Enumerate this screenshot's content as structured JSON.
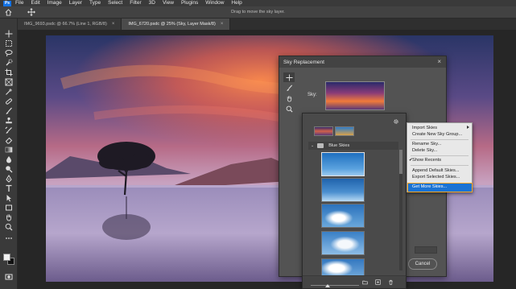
{
  "menubar": {
    "app_icon": "Ps",
    "items": [
      "File",
      "Edit",
      "Image",
      "Layer",
      "Type",
      "Select",
      "Filter",
      "3D",
      "View",
      "Plugins",
      "Window",
      "Help"
    ]
  },
  "optionsbar": {
    "hint": "Drag to move the sky layer."
  },
  "tabs": [
    {
      "label": "IMG_9693.psdc @ 66.7% (Line 1, RGB/8)",
      "active": false
    },
    {
      "label": "IMG_6720.psdc @ 25% (Sky, Layer Mask/8)",
      "active": true
    }
  ],
  "tools": [
    "move-icon",
    "marquee-icon",
    "lasso-icon",
    "quick-select-icon",
    "crop-icon",
    "frame-icon",
    "eyedropper-icon",
    "healing-icon",
    "brush-icon",
    "stamp-icon",
    "history-brush-icon",
    "eraser-icon",
    "gradient-icon",
    "blur-icon",
    "dodge-icon",
    "pen-icon",
    "type-icon",
    "path-select-icon",
    "shape-icon",
    "hand-icon",
    "zoom-icon",
    "more-icon"
  ],
  "dialog": {
    "title": "Sky Replacement",
    "sky_label": "Sky:",
    "cancel_label": "Cancel"
  },
  "sky_picker": {
    "group_name": "Blue Skies"
  },
  "context_menu": {
    "items": {
      "import_skies": "Import Skies",
      "create_group": "Create New Sky Group...",
      "rename_sky": "Rename Sky...",
      "delete_sky": "Delete Sky...",
      "show_recents": "Show Recents",
      "append_default": "Append Default Skies...",
      "export_selected": "Export Selected Skies...",
      "get_more": "Get More Skies..."
    },
    "show_recents_checked": true,
    "highlighted": "get_more"
  },
  "colors": {
    "accent": "#1a73d4",
    "highlight_outline": "#f5a623"
  }
}
